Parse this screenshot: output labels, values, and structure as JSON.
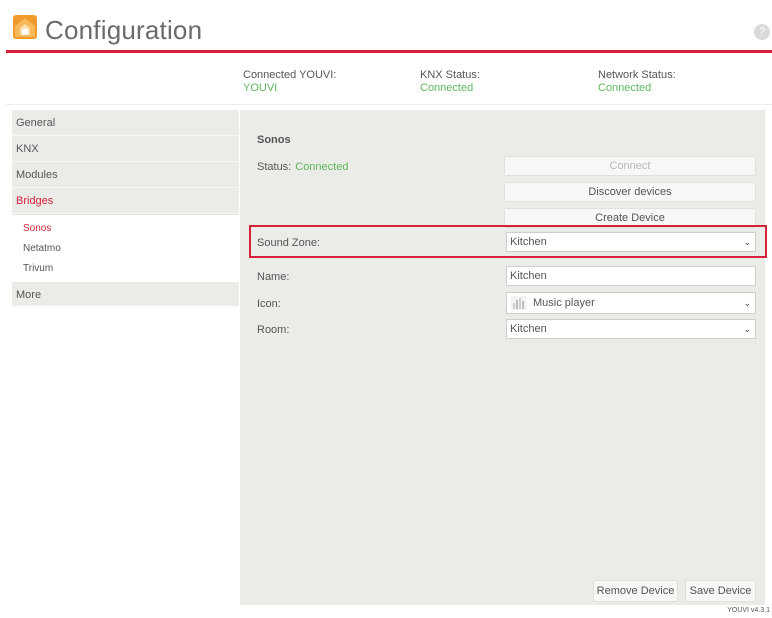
{
  "header": {
    "title": "Configuration",
    "help_glyph": "?",
    "accent_color": "#d6213a"
  },
  "status_bar": {
    "youvi": {
      "label": "Connected YOUVI:",
      "value": "YOUVI"
    },
    "knx": {
      "label": "KNX Status:",
      "value": "Connected"
    },
    "network": {
      "label": "Network Status:",
      "value": "Connected"
    },
    "ok_color": "#5cb85c"
  },
  "sidebar": {
    "items": [
      {
        "label": "General"
      },
      {
        "label": "KNX"
      },
      {
        "label": "Modules"
      },
      {
        "label": "Bridges",
        "active": true
      }
    ],
    "bridges_sub": [
      {
        "label": "Sonos",
        "active": true
      },
      {
        "label": "Netatmo"
      },
      {
        "label": "Trivum"
      }
    ],
    "more": "More"
  },
  "main": {
    "section_title": "Sonos",
    "status_label": "Status:",
    "status_value": "Connected",
    "buttons": {
      "connect": "Connect",
      "discover": "Discover devices",
      "create": "Create Device",
      "remove": "Remove Device",
      "save": "Save Device"
    },
    "form": {
      "sound_zone": {
        "label": "Sound Zone:",
        "value": "Kitchen"
      },
      "name": {
        "label": "Name:",
        "value": "Kitchen"
      },
      "icon": {
        "label": "Icon:",
        "value": "Music player",
        "icon": "music-player-icon"
      },
      "room": {
        "label": "Room:",
        "value": "Kitchen"
      }
    }
  },
  "footer": {
    "version": "YOUVI v4.3.1"
  }
}
